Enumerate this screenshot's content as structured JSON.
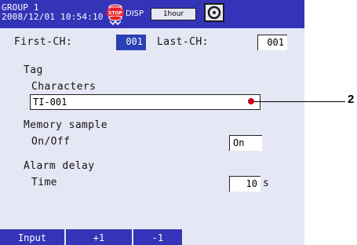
{
  "header": {
    "group": "GROUP 1",
    "datetime": "2008/12/01 10:54:10",
    "stop_icon_text": "STOP",
    "disp_label": "DISP",
    "interval": "1hour",
    "stop_icon": "stop-icon",
    "media_icon": "media-icon"
  },
  "channels": {
    "first_label": "First-CH:",
    "first_value": "001",
    "last_label": "Last-CH:",
    "last_value": "001"
  },
  "tag": {
    "section": "Tag",
    "characters_label": "Characters",
    "characters_value": "TI-001"
  },
  "memory_sample": {
    "section": "Memory sample",
    "onoff_label": "On/Off",
    "onoff_value": "On"
  },
  "alarm_delay": {
    "section": "Alarm delay",
    "time_label": "Time",
    "time_value": "10",
    "time_unit": "s"
  },
  "softkeys": [
    "Input",
    "+1",
    "-1"
  ],
  "callout": {
    "number": "2"
  },
  "colors": {
    "header_bg": "#3434b8",
    "screen_bg": "#e6e7f4",
    "selected_bg": "#2a40b4",
    "callout_dot": "#c8001e"
  }
}
